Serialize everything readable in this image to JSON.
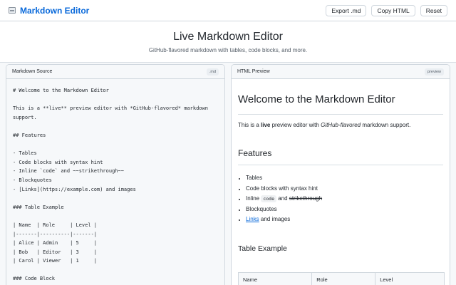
{
  "app": {
    "title": "Markdown Editor",
    "icon": "keyboard-icon"
  },
  "toolbar": {
    "export_label": "Export .md",
    "copy_label": "Copy HTML",
    "reset_label": "Reset"
  },
  "hero": {
    "title": "Live Markdown Editor",
    "subtitle": "GitHub-flavored markdown with tables, code blocks, and more."
  },
  "source_panel": {
    "title": "Markdown Source",
    "badge": ".md",
    "lines": [
      "# Welcome to the Markdown Editor",
      "",
      "This is a **live** preview editor with *GitHub-flavored* markdown",
      "support.",
      "",
      "## Features",
      "",
      "- Tables",
      "- Code blocks with syntax hint",
      "- Inline `code` and ~~strikethrough~~",
      "- Blockquotes",
      "- [Links](https://example.com) and images",
      "",
      "### Table Example",
      "",
      "| Name  | Role     | Level |",
      "|-------|----------|-------|",
      "| Alice | Admin    | 5     |",
      "| Bob   | Editor   | 3     |",
      "| Carol | Viewer   | 1     |",
      "",
      "### Code Block"
    ]
  },
  "preview_panel": {
    "title": "HTML Preview",
    "badge": "preview",
    "h1": "Welcome to the Markdown Editor",
    "intro": {
      "before": "This is a ",
      "bold": "live",
      "middle": " preview editor with ",
      "italic": "GitHub-flavored",
      "after": " markdown support."
    },
    "h2": "Features",
    "features": {
      "item1": "Tables",
      "item2": "Code blocks with syntax hint",
      "item3_before": "Inline ",
      "item3_code": "code",
      "item3_middle": " and ",
      "item3_strike": "strikethrough",
      "item4": "Blockquotes",
      "item5_link": "Links",
      "item5_after": " and images"
    },
    "h3": "Table Example",
    "table_headers": [
      "Name",
      "Role",
      "Level"
    ]
  }
}
